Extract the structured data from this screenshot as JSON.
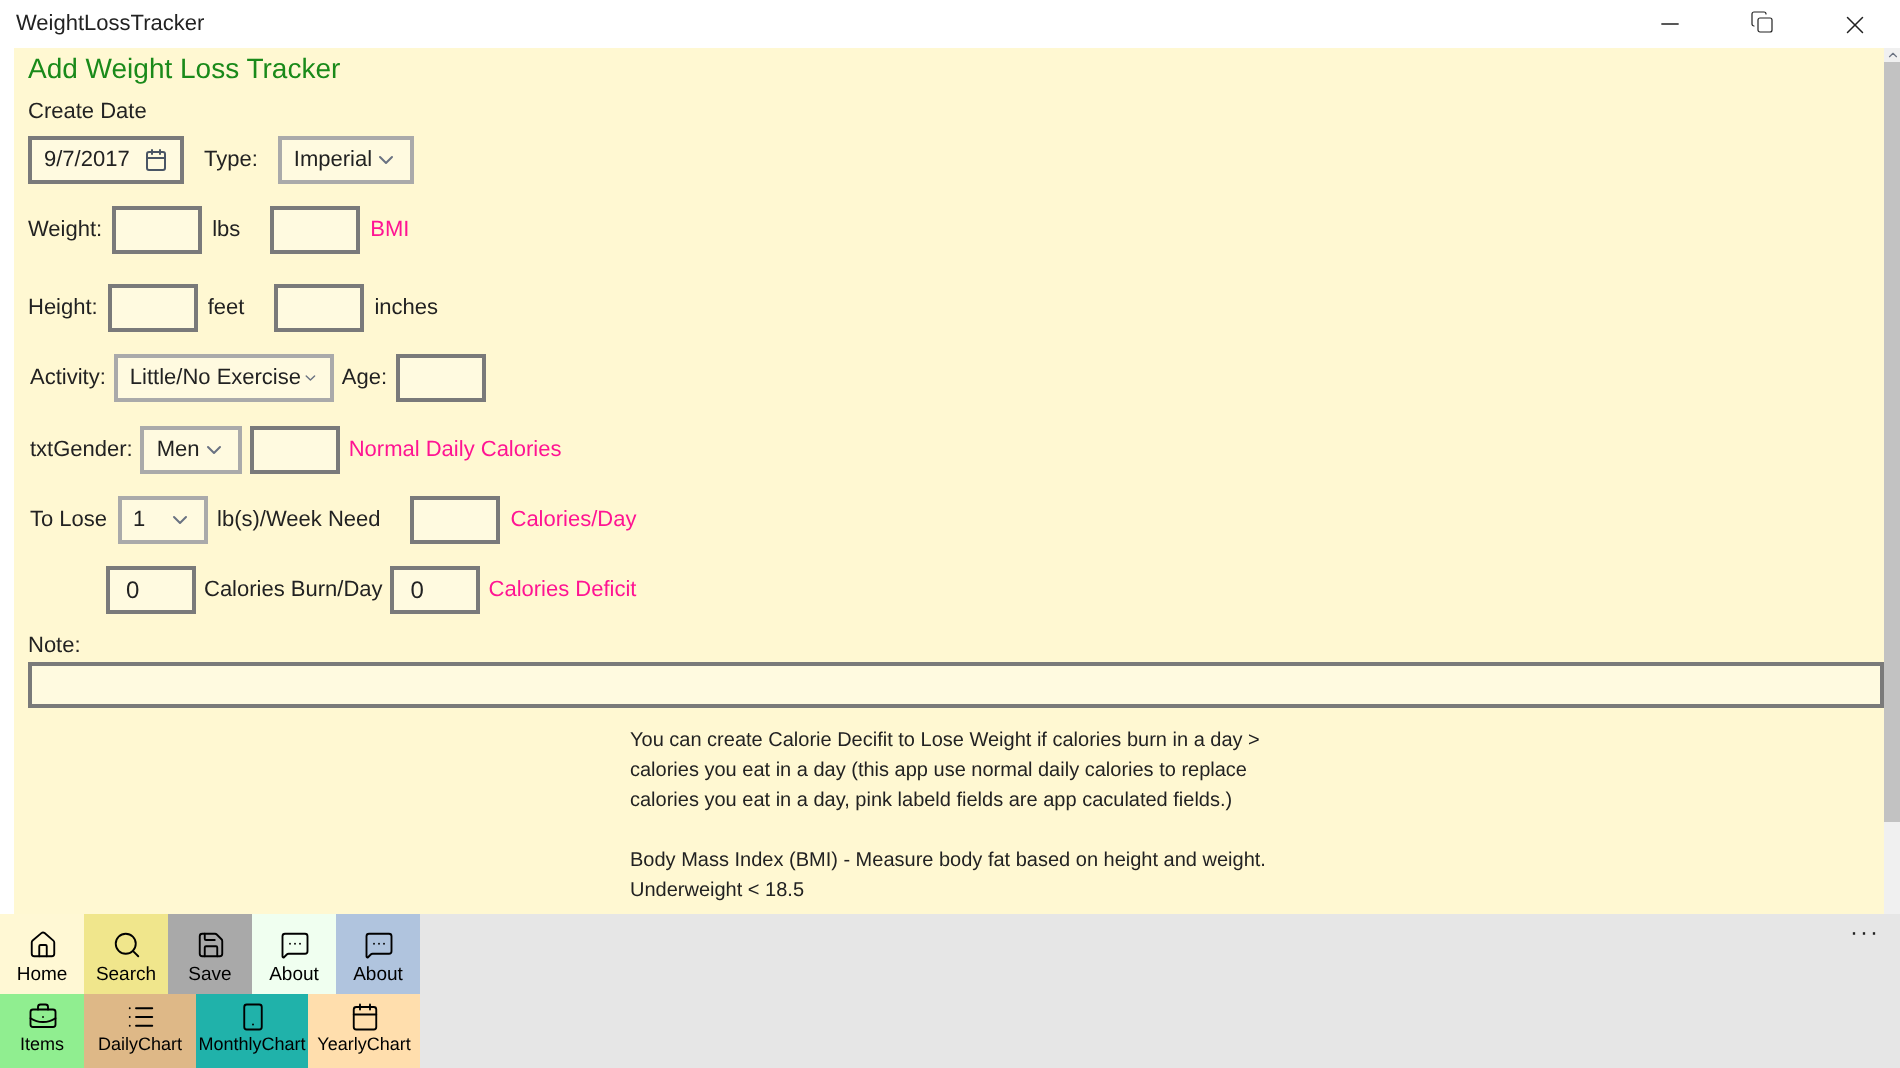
{
  "window": {
    "title": "WeightLossTracker"
  },
  "heading": "Add Weight Loss Tracker",
  "create_date": {
    "label": "Create Date",
    "value": "9/7/2017"
  },
  "type": {
    "label": "Type:",
    "value": "Imperial"
  },
  "weight": {
    "label": "Weight:",
    "unit": "lbs",
    "bmi_label": "BMI"
  },
  "height": {
    "label": "Height:",
    "feet_unit": "feet",
    "inches_unit": "inches"
  },
  "activity": {
    "label": "Activity:",
    "value": "Little/No Exercise",
    "age_label": "Age:"
  },
  "gender": {
    "label": "txtGender:",
    "value": "Men",
    "calories_label": "Normal Daily Calories"
  },
  "to_lose": {
    "label": "To Lose",
    "value": "1",
    "unit": "lb(s)/Week Need",
    "calories_label": "Calories/Day"
  },
  "burn": {
    "value": "0",
    "label": "Calories Burn/Day",
    "deficit_value": "0",
    "deficit_label": "Calories Deficit"
  },
  "note": {
    "label": "Note:"
  },
  "info": [
    "You can create Calorie Decifit to Lose Weight if calories burn in a day > calories you eat in a day (this app use normal daily calories to replace calories you eat in a day, pink labeld fields are app caculated fields.)",
    "Body Mass Index (BMI) - Measure body fat based on height and weight.",
    "Underweight < 18.5"
  ],
  "command_rows": [
    [
      {
        "label": "Home",
        "kind": "home",
        "color": "#fff8d4"
      },
      {
        "label": "Search",
        "kind": "search",
        "color": "#f0e68c"
      },
      {
        "label": "Save",
        "kind": "save",
        "color": "#a9a9a9"
      },
      {
        "label": "About",
        "kind": "message",
        "color": "#f0fff0"
      },
      {
        "label": "About",
        "kind": "message",
        "color": "#b0c4de"
      }
    ],
    [
      {
        "label": "Items",
        "kind": "items",
        "color": "#90ee90"
      },
      {
        "label": "DailyChart",
        "kind": "list",
        "color": "#deb887"
      },
      {
        "label": "MonthlyChart",
        "kind": "page",
        "color": "#20b2aa"
      },
      {
        "label": "YearlyChart",
        "kind": "calendar",
        "color": "#ffdead"
      }
    ]
  ],
  "more": "···"
}
